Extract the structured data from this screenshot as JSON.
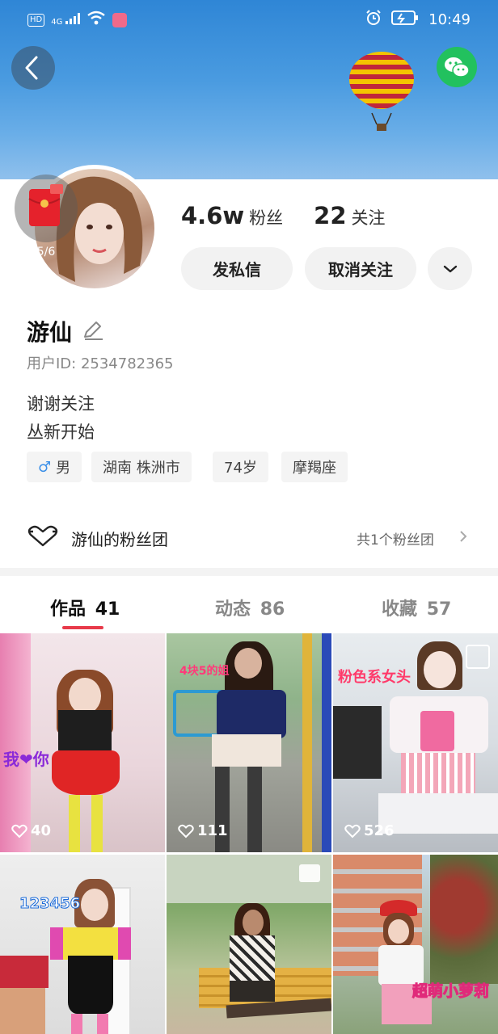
{
  "status_bar": {
    "hd": "HD",
    "network": "4G",
    "time": "10:49",
    "icons": [
      "hd-icon",
      "signal-icon",
      "wifi-icon",
      "app-notification-icon",
      "alarm-icon",
      "battery-icon"
    ]
  },
  "header": {
    "back_icon": "chevron-left-icon",
    "share_icon": "wechat-icon"
  },
  "profile": {
    "redpacket_count": "5/6",
    "fans_count": "4.6w",
    "fans_label": "粉丝",
    "following_count": "22",
    "following_label": "关注",
    "message_button": "发私信",
    "unfollow_button": "取消关注",
    "name": "游仙",
    "user_id": "用户ID: 2534782365",
    "bio_lines": [
      "谢谢关注",
      "丛新开始"
    ],
    "tags": {
      "gender_symbol": "♂",
      "gender": "男",
      "location": "湖南 株洲市",
      "age": "74岁",
      "zodiac": "摩羯座"
    }
  },
  "fan_club": {
    "title": "游仙的粉丝团",
    "count_text": "共1个粉丝团"
  },
  "tabs": [
    {
      "label": "作品",
      "count": "41"
    },
    {
      "label": "动态",
      "count": "86"
    },
    {
      "label": "收藏",
      "count": "57"
    }
  ],
  "posts": [
    {
      "likes": "40",
      "overlay": "我❤你"
    },
    {
      "likes": "111",
      "overlay": "4块5的姐"
    },
    {
      "likes": "526",
      "overlay": "粉色系女头"
    },
    {
      "likes": "",
      "overlay": "123456"
    },
    {
      "likes": "",
      "overlay": ""
    },
    {
      "likes": "",
      "overlay": "超萌小萝莉"
    }
  ],
  "colors": {
    "accent": "#e83a4a",
    "wechat_green": "#22c15e",
    "banner_sky": "#3a8fdc"
  }
}
